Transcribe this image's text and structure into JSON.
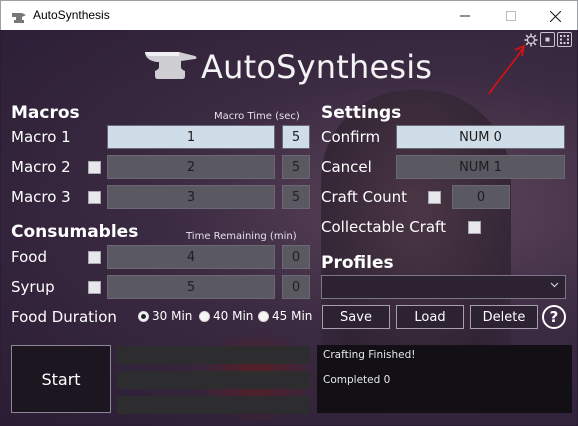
{
  "window": {
    "title": "AutoSynthesis"
  },
  "logo": {
    "text": "AutoSynthesis"
  },
  "macros": {
    "heading": "Macros",
    "time_header": "Macro Time (sec)",
    "rows": [
      {
        "label": "Macro 1",
        "value": "1",
        "time": "5",
        "has_checkbox": false,
        "enabled": true
      },
      {
        "label": "Macro 2",
        "value": "2",
        "time": "5",
        "has_checkbox": true,
        "enabled": false
      },
      {
        "label": "Macro 3",
        "value": "3",
        "time": "5",
        "has_checkbox": true,
        "enabled": false
      }
    ]
  },
  "consumables": {
    "heading": "Consumables",
    "time_header": "Time Remaining (min)",
    "rows": [
      {
        "label": "Food",
        "value": "4",
        "remaining": "0"
      },
      {
        "label": "Syrup",
        "value": "5",
        "remaining": "0"
      }
    ],
    "duration_label": "Food Duration",
    "durations": [
      {
        "label": "30 Min",
        "selected": true
      },
      {
        "label": "40 Min",
        "selected": false
      },
      {
        "label": "45 Min",
        "selected": false
      }
    ]
  },
  "settings": {
    "heading": "Settings",
    "confirm_label": "Confirm",
    "confirm_value": "NUM 0",
    "cancel_label": "Cancel",
    "cancel_value": "NUM 1",
    "craft_count_label": "Craft Count",
    "craft_count_value": "0",
    "collectable_label": "Collectable Craft"
  },
  "profiles": {
    "heading": "Profiles",
    "selected": "",
    "save_label": "Save",
    "load_label": "Load",
    "delete_label": "Delete",
    "help_label": "?"
  },
  "footer": {
    "start_label": "Start",
    "status_lines": [
      "Crafting Finished!",
      "Completed 0"
    ]
  },
  "colors": {
    "accent_field": "#cfdde8",
    "disabled_field": "#5a5860",
    "annotation_arrow": "#e01010"
  }
}
